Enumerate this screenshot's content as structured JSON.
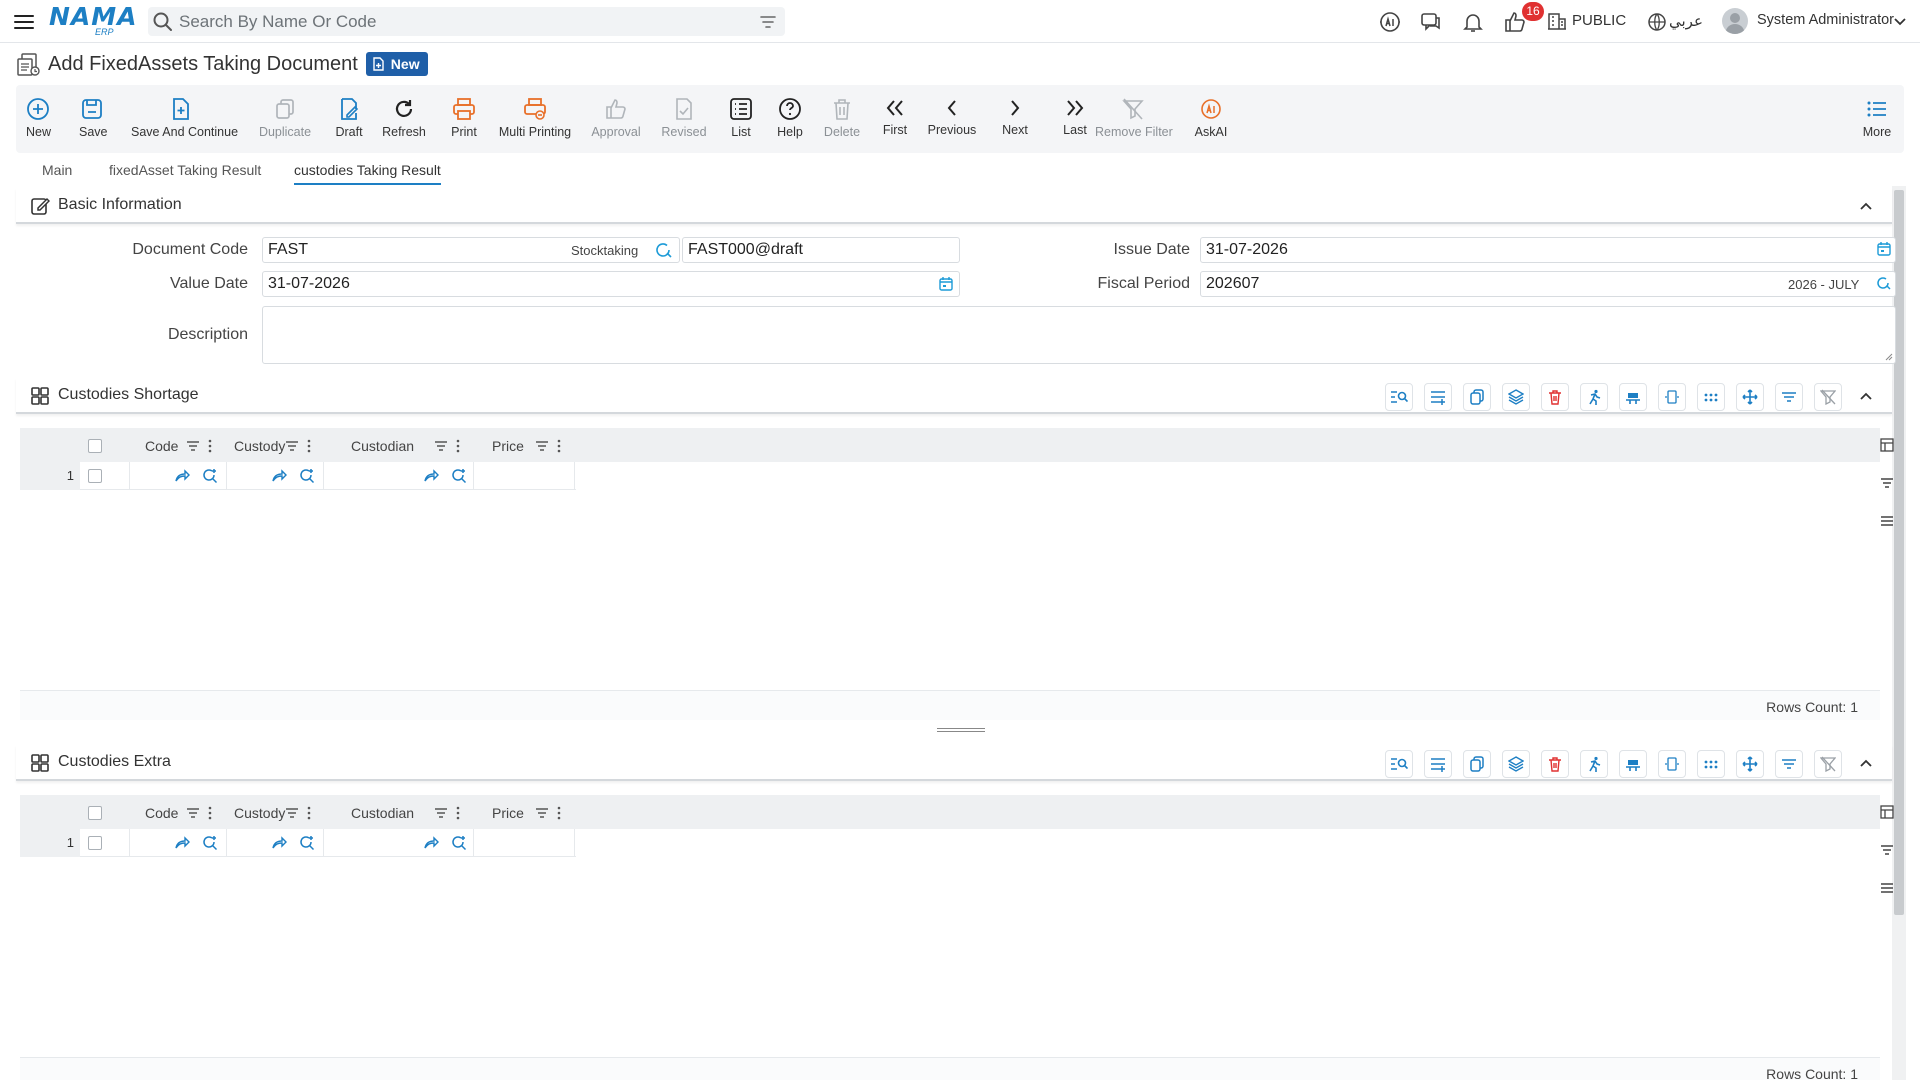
{
  "app": {
    "logo_text": "NAMA",
    "logo_sub": "ERP",
    "search_placeholder": "Search By Name Or Code",
    "notif_count": "16",
    "branch": "PUBLIC",
    "language": "عربي",
    "user": "System Administrator"
  },
  "page": {
    "title": "Add FixedAssets Taking Document",
    "status_badge": "New"
  },
  "toolbar": {
    "new": "New",
    "save": "Save",
    "save_continue": "Save And Continue",
    "duplicate": "Duplicate",
    "draft": "Draft",
    "refresh": "Refresh",
    "print": "Print",
    "multi_printing": "Multi Printing",
    "approval": "Approval",
    "revised": "Revised",
    "list": "List",
    "help": "Help",
    "delete": "Delete",
    "first": "First",
    "previous": "Previous",
    "next": "Next",
    "last": "Last",
    "remove_filter": "Remove Filter",
    "askai": "AskAI",
    "more": "More"
  },
  "tabs": [
    "Main",
    "fixedAsset Taking Result",
    "custodies Taking Result"
  ],
  "active_tab": "custodies Taking Result",
  "basic_info": {
    "title": "Basic Information",
    "document_code_label": "Document Code",
    "document_code_value": "FAST",
    "document_type": "Stocktaking",
    "document_number": "FAST000@draft",
    "issue_date_label": "Issue Date",
    "issue_date_value": "31-07-2026",
    "value_date_label": "Value Date",
    "value_date_value": "31-07-2026",
    "fiscal_period_label": "Fiscal Period",
    "fiscal_period_value": "202607",
    "fiscal_period_name": "2026 - JULY",
    "description_label": "Description",
    "description_value": ""
  },
  "grids": {
    "columns": [
      "Code",
      "Custody",
      "Custodian",
      "Price"
    ],
    "shortage": {
      "title": "Custodies Shortage",
      "row_number": "1",
      "rows_count": "Rows Count: 1"
    },
    "extra": {
      "title": "Custodies Extra",
      "row_number": "1",
      "rows_count": "Rows Count: 1"
    }
  },
  "colors": {
    "brand": "#1d7fc4",
    "badge_new": "#1f5fa8",
    "notify_red": "#e03131",
    "print_orange": "#e8702a",
    "delete_red": "#e03131"
  }
}
